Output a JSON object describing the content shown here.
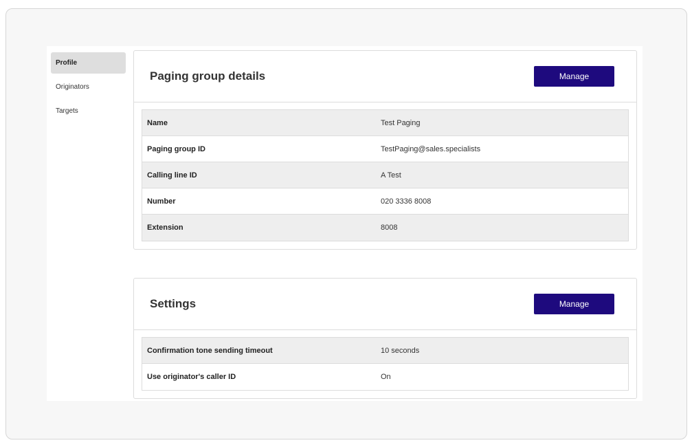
{
  "sidebar": {
    "items": [
      {
        "label": "Profile"
      },
      {
        "label": "Originators"
      },
      {
        "label": "Targets"
      }
    ]
  },
  "details": {
    "title": "Paging group details",
    "manage_label": "Manage",
    "rows": [
      {
        "key": "Name",
        "value": "Test Paging"
      },
      {
        "key": "Paging group ID",
        "value": "TestPaging@sales.specialists"
      },
      {
        "key": "Calling line ID",
        "value": "A Test"
      },
      {
        "key": "Number",
        "value": "020 3336 8008"
      },
      {
        "key": "Extension",
        "value": "8008"
      }
    ]
  },
  "settings": {
    "title": "Settings",
    "manage_label": "Manage",
    "rows": [
      {
        "key": "Confirmation tone sending timeout",
        "value": "10 seconds"
      },
      {
        "key": "Use originator's caller ID",
        "value": "On"
      }
    ]
  },
  "colors": {
    "accent": "#1e0a7e",
    "row_shade": "#eeeeee",
    "nav_active": "#dedede"
  }
}
